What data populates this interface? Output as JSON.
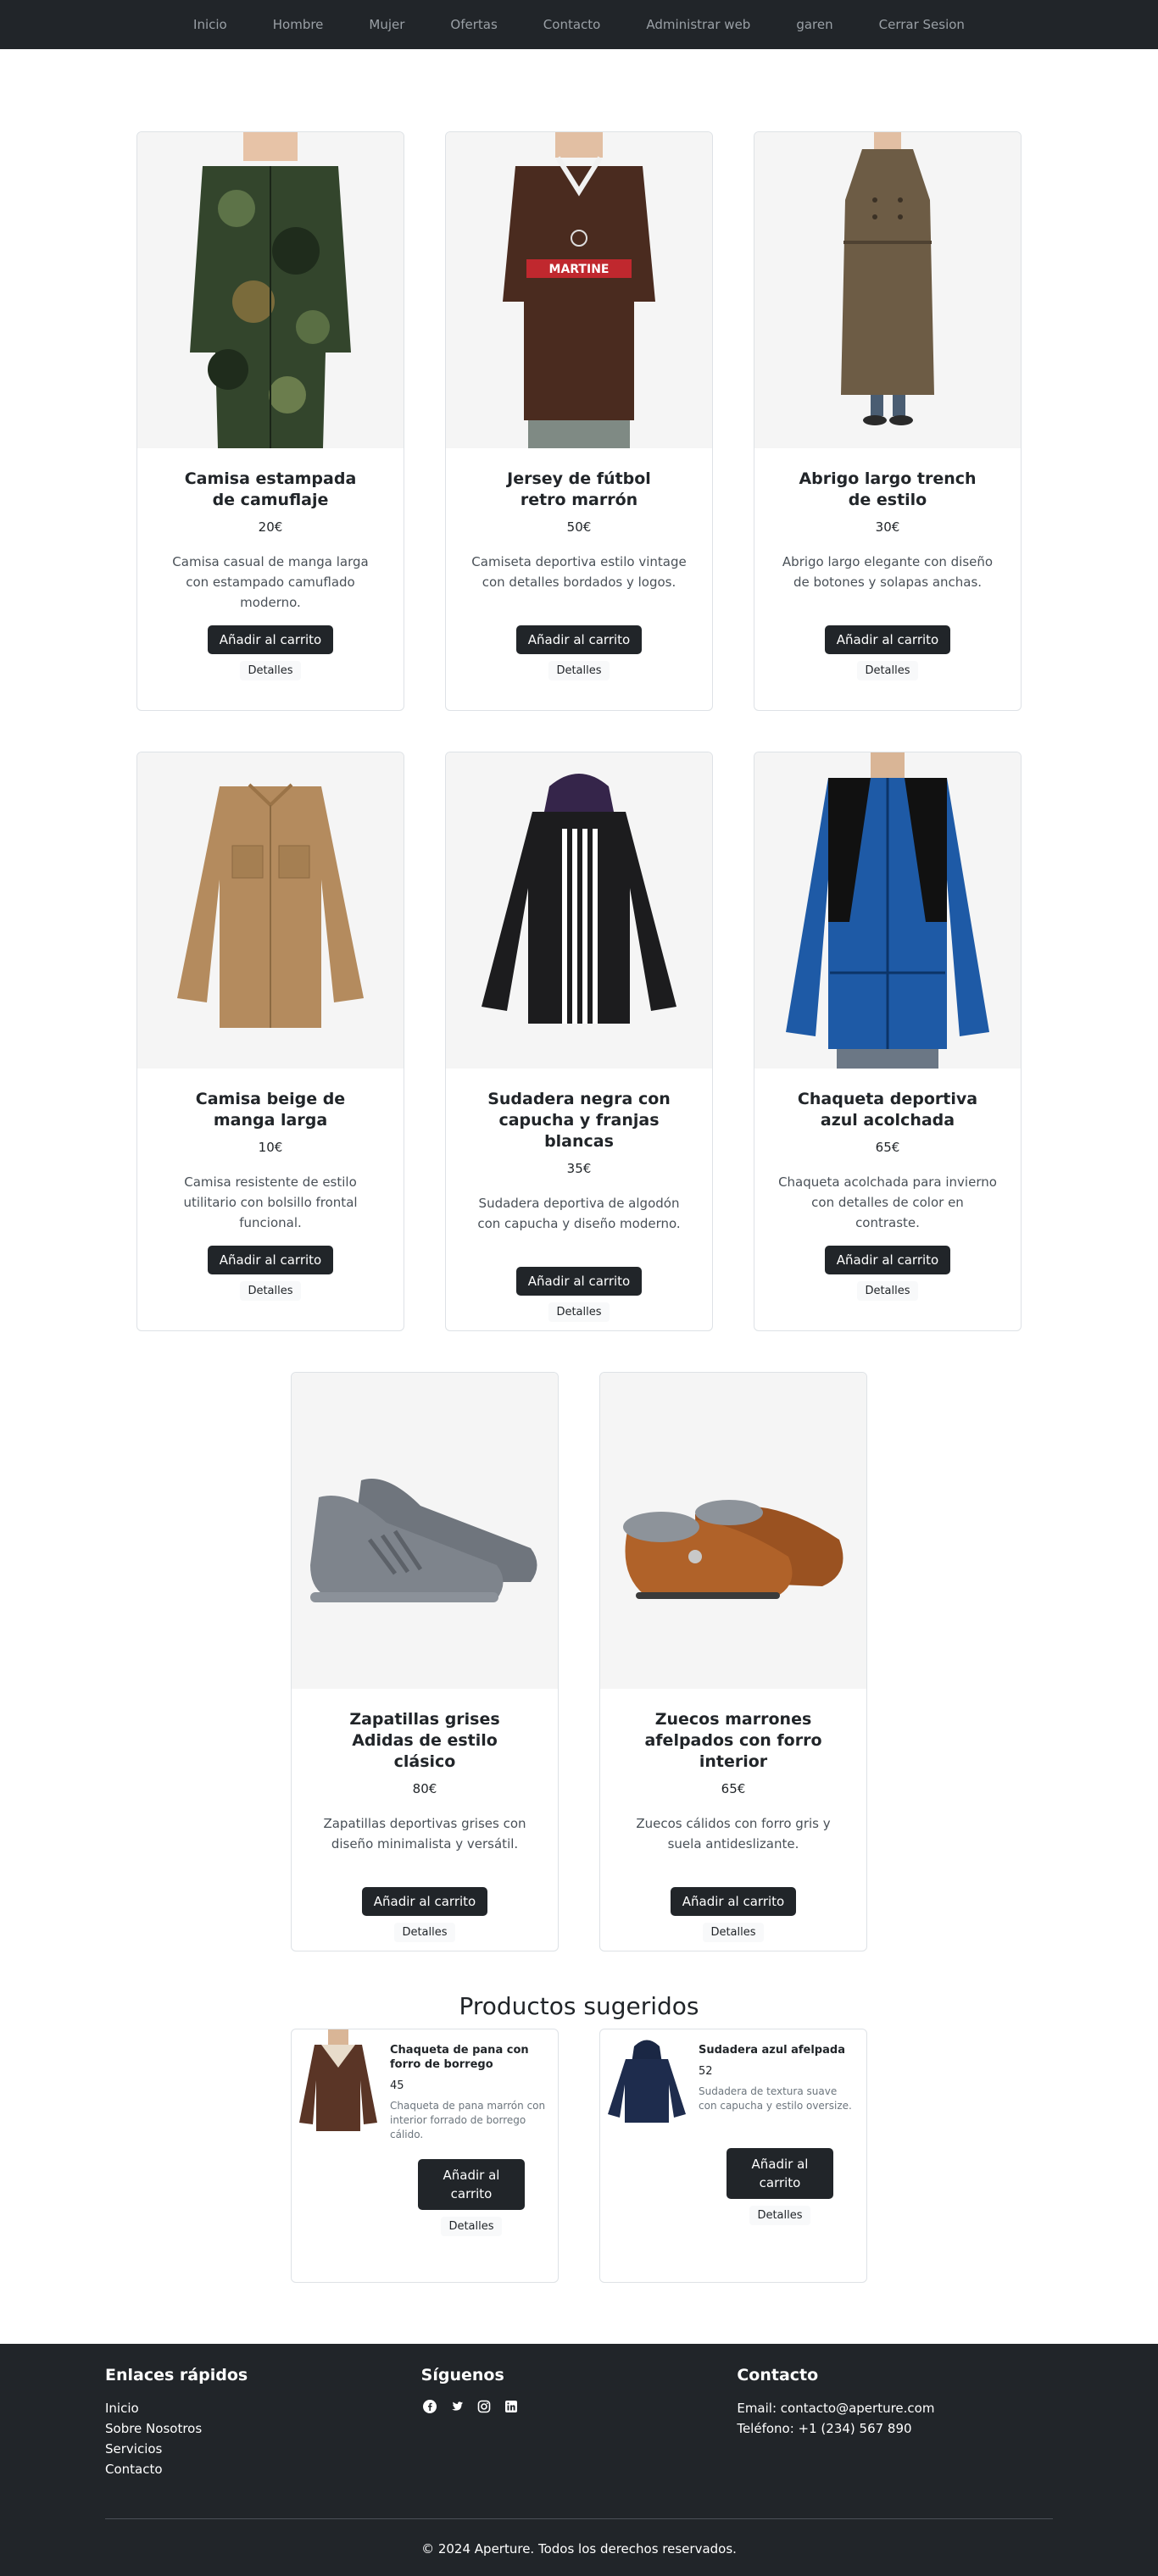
{
  "nav": {
    "items": [
      "Inicio",
      "Hombre",
      "Mujer",
      "Ofertas",
      "Contacto",
      "Administrar web",
      "garen",
      "Cerrar Sesion"
    ]
  },
  "products": [
    {
      "title": "Camisa estampada de camuflaje",
      "price": "20€",
      "description": "Camisa casual de manga larga con estampado camuflado moderno.",
      "cart_label": "Añadir al carrito",
      "details_label": "Detalles",
      "image": "camo-shirt"
    },
    {
      "title": "Jersey de fútbol retro marrón",
      "price": "50€",
      "description": "Camiseta deportiva estilo vintage con detalles bordados y logos.",
      "cart_label": "Añadir al carrito",
      "details_label": "Detalles",
      "image": "football-jersey"
    },
    {
      "title": "Abrigo largo trench de estilo",
      "price": "30€",
      "description": "Abrigo largo elegante con diseño de botones y solapas anchas.",
      "cart_label": "Añadir al carrito",
      "details_label": "Detalles",
      "image": "trench-coat"
    },
    {
      "title": "Camisa beige de manga larga",
      "price": "10€",
      "description": "Camisa resistente de estilo utilitario con bolsillo frontal funcional.",
      "cart_label": "Añadir al carrito",
      "details_label": "Detalles",
      "image": "beige-shirt"
    },
    {
      "title": "Sudadera negra con capucha y franjas blancas",
      "price": "35€",
      "description": "Sudadera deportiva de algodón con capucha y diseño moderno.",
      "cart_label": "Añadir al carrito",
      "details_label": "Detalles",
      "image": "black-hoodie"
    },
    {
      "title": "Chaqueta deportiva azul acolchada",
      "price": "65€",
      "description": "Chaqueta acolchada para invierno con detalles de color en contraste.",
      "cart_label": "Añadir al carrito",
      "details_label": "Detalles",
      "image": "blue-jacket"
    },
    {
      "title": "Zapatillas grises Adidas de estilo clásico",
      "price": "80€",
      "description": "Zapatillas deportivas grises con diseño minimalista y versátil.",
      "cart_label": "Añadir al carrito",
      "details_label": "Detalles",
      "image": "grey-sneakers"
    },
    {
      "title": "Zuecos marrones afelpados con forro interior",
      "price": "65€",
      "description": "Zuecos cálidos con forro gris y suela antideslizante.",
      "cart_label": "Añadir al carrito",
      "details_label": "Detalles",
      "image": "brown-clogs"
    }
  ],
  "suggested": {
    "heading": "Productos sugeridos",
    "items": [
      {
        "title": "Chaqueta de pana con forro de borrego",
        "price": "45",
        "description": "Chaqueta de pana marrón con interior forrado de borrego cálido.",
        "cart_label": "Añadir al carrito",
        "details_label": "Detalles",
        "image": "corduroy-jacket"
      },
      {
        "title": "Sudadera azul afelpada",
        "price": "52",
        "description": "Sudadera de textura suave con capucha y estilo oversize.",
        "cart_label": "Añadir al carrito",
        "details_label": "Detalles",
        "image": "navy-fleece"
      }
    ]
  },
  "footer": {
    "links_heading": "Enlaces rápidos",
    "links": [
      "Inicio",
      "Sobre Nosotros",
      "Servicios",
      "Contacto"
    ],
    "social_heading": "Síguenos",
    "social_icons": [
      "facebook-icon",
      "twitter-icon",
      "instagram-icon",
      "linkedin-icon"
    ],
    "contact_heading": "Contacto",
    "email": "Email: contacto@aperture.com",
    "phone": "Teléfono: +1 (234) 567 890",
    "copyright": "© 2024 Aperture. Todos los derechos reservados."
  },
  "colors": {
    "dark": "#212529",
    "nav_text": "#9aa0a6",
    "card_bg": "#f5f5f5"
  }
}
